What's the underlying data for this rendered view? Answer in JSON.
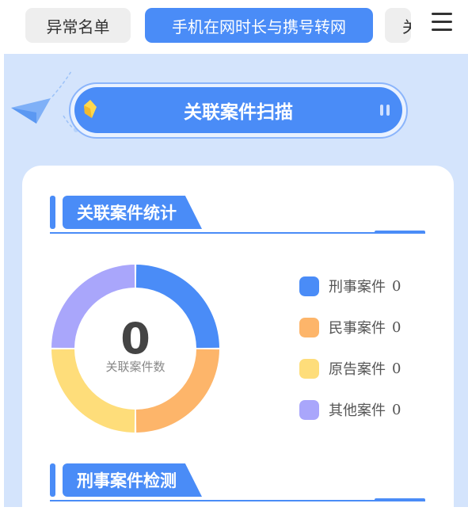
{
  "tabs": [
    {
      "label": "异常名单",
      "active": false
    },
    {
      "label": "手机在网时长与携号转网",
      "active": true
    },
    {
      "label": "关",
      "active": false
    }
  ],
  "menu_icon": "hamburger-menu-icon",
  "scan": {
    "label": "关联案件扫描"
  },
  "stats": {
    "title": "关联案件统计",
    "total": "0",
    "total_label": "关联案件数",
    "legend": [
      {
        "label": "刑事案件",
        "count": "0",
        "color": "#4a8cf7"
      },
      {
        "label": "民事案件",
        "count": "0",
        "color": "#fdb56a"
      },
      {
        "label": "原告案件",
        "count": "0",
        "color": "#fedd7a"
      },
      {
        "label": "其他案件",
        "count": "0",
        "color": "#a9a6fb"
      }
    ]
  },
  "detect": {
    "title": "刑事案件检测"
  },
  "chart_data": {
    "type": "pie",
    "categories": [
      "刑事案件",
      "民事案件",
      "原告案件",
      "其他案件"
    ],
    "values": [
      0,
      0,
      0,
      0
    ],
    "colors": [
      "#4a8cf7",
      "#fdb56a",
      "#fedd7a",
      "#a9a6fb"
    ]
  },
  "colors": {
    "accent": "#4a8cf7",
    "page_bg": "#d4e4fc"
  }
}
